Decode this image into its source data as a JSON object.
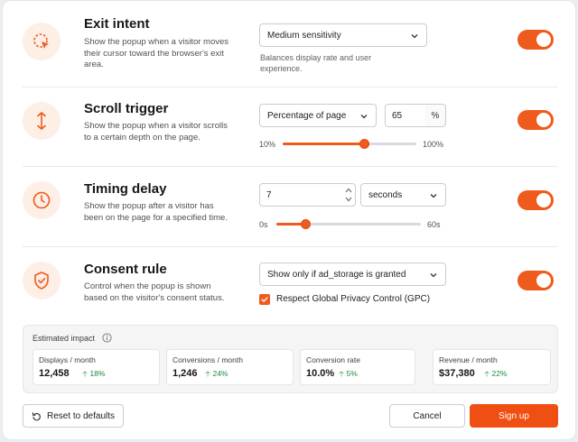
{
  "rules": [
    {
      "title": "Exit intent",
      "description": "Show the popup when a visitor moves their cursor toward the browser's exit area.",
      "icon": "cursor-exit-icon",
      "select_value": "Medium sensitivity",
      "hint": "Balances display rate and user experience.",
      "enabled": true
    },
    {
      "title": "Scroll trigger",
      "description": "Show the popup when a visitor scrolls to a certain depth on the page.",
      "icon": "scroll-arrows-icon",
      "select_value": "Percentage of page",
      "input_value": "65",
      "suffix": "%",
      "slider_min": "10%",
      "slider_max": "100%",
      "slider_level": 0.61,
      "enabled": true
    },
    {
      "title": "Timing delay",
      "description": "Show the popup after a visitor has been on the page for a specified time.",
      "icon": "clock-icon",
      "input_value": "7",
      "select_value": "seconds",
      "slider_min": "0s",
      "slider_max": "60s",
      "slider_level": 0.2,
      "enabled": true
    },
    {
      "title": "Consent rule",
      "description": "Control when the popup is shown based on the visitor's consent status.",
      "icon": "shield-check-icon",
      "select_value": "Show only if ad_storage is granted",
      "checkbox_label": "Respect Global Privacy Control (GPC)",
      "checkbox_checked": true,
      "enabled": true
    }
  ],
  "impact": {
    "title": "Estimated impact",
    "cards": [
      {
        "label": "Displays / month",
        "value": "12,458",
        "delta": "18%"
      },
      {
        "label": "Conversions / month",
        "value": "1,246",
        "delta": "24%"
      },
      {
        "label": "Conversion rate",
        "value": "10.0%",
        "delta": "5%"
      },
      {
        "label": "Revenue / month",
        "value": "$37,380",
        "delta": "22%"
      }
    ]
  },
  "footer": {
    "reset_label": "Reset to defaults",
    "cancel_label": "Cancel",
    "submit_label": "Sign up"
  },
  "colors": {
    "accent": "#ef5a1d",
    "positive": "#1d8a3e"
  }
}
